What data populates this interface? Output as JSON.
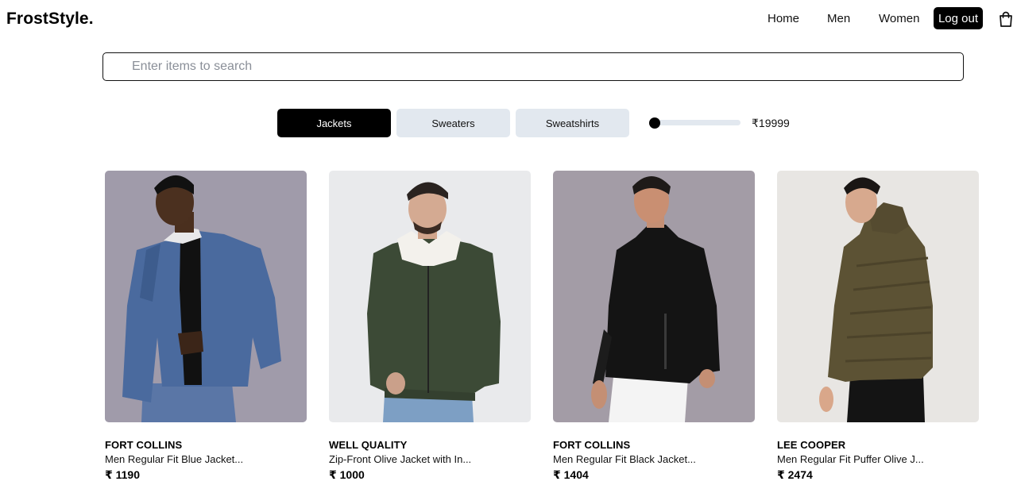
{
  "header": {
    "logo": "FrostStyle.",
    "nav": {
      "home": "Home",
      "men": "Men",
      "women": "Women"
    },
    "logout_label": "Log out",
    "cart_icon": "shopping-bag-icon"
  },
  "search": {
    "placeholder": "Enter items to search",
    "value": ""
  },
  "categories": [
    {
      "label": "Jackets",
      "active": true
    },
    {
      "label": "Sweaters",
      "active": false
    },
    {
      "label": "Sweatshirts",
      "active": false
    }
  ],
  "price_filter": {
    "max_label": "₹19999",
    "value_fraction": 0.0
  },
  "colors": {
    "accent": "#000000",
    "chip_inactive": "#e2e8ef"
  },
  "products": [
    {
      "brand": "FORT COLLINS",
      "name": "Men Regular Fit Blue Jacket...",
      "price": "₹ 1190",
      "image": "blue-jacket-model-photo"
    },
    {
      "brand": "WELL QUALITY",
      "name": "Zip-Front Olive Jacket with In...",
      "price": "₹ 1000",
      "image": "olive-jacket-model-photo"
    },
    {
      "brand": "FORT COLLINS",
      "name": "Men Regular Fit Black Jacket...",
      "price": "₹ 1404",
      "image": "black-jacket-model-photo"
    },
    {
      "brand": "LEE COOPER",
      "name": "Men Regular Fit Puffer Olive J...",
      "price": "₹ 2474",
      "image": "olive-puffer-jacket-model-photo"
    }
  ]
}
